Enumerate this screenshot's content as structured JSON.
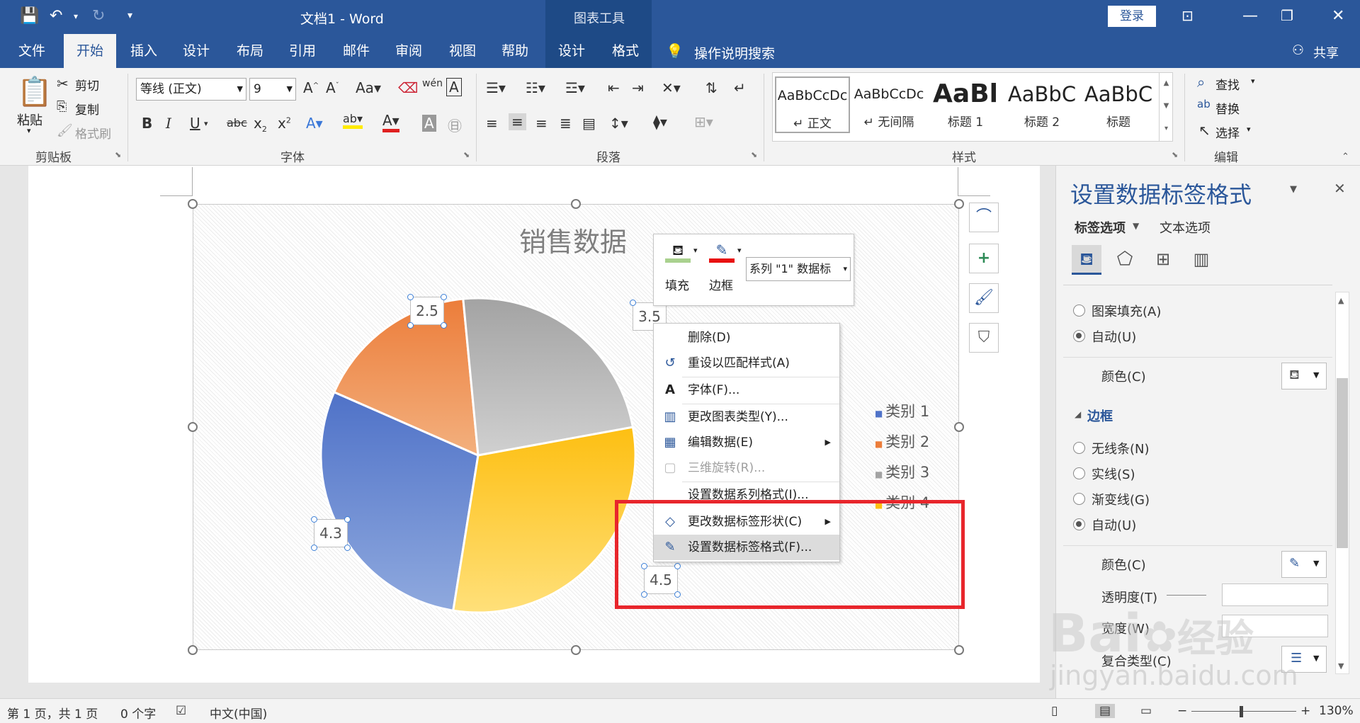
{
  "titlebar": {
    "doc_title": "文档1  -  Word",
    "context_label": "图表工具",
    "login": "登录"
  },
  "tabs": [
    "文件",
    "开始",
    "插入",
    "设计",
    "布局",
    "引用",
    "邮件",
    "审阅",
    "视图",
    "帮助",
    "设计",
    "格式"
  ],
  "tell_me": "操作说明搜索",
  "share": "共享",
  "ribbon": {
    "clipboard": {
      "label": "剪贴板",
      "paste": "粘贴",
      "cut": "剪切",
      "copy": "复制",
      "painter": "格式刷"
    },
    "font": {
      "label": "字体",
      "font_name": "等线 (正文)",
      "font_size": "9"
    },
    "paragraph": {
      "label": "段落"
    },
    "styles": {
      "label": "样式",
      "items": [
        {
          "preview": "AaBbCcDc",
          "name": "↵ 正文"
        },
        {
          "preview": "AaBbCcDc",
          "name": "↵ 无间隔"
        },
        {
          "preview": "AaBl",
          "name": "标题 1"
        },
        {
          "preview": "AaBbC",
          "name": "标题 2"
        },
        {
          "preview": "AaBbC",
          "name": "标题"
        }
      ]
    },
    "editing": {
      "label": "编辑",
      "find": "查找",
      "replace": "替换",
      "select": "选择"
    }
  },
  "chart": {
    "title": "销售数据",
    "labels": [
      "2.5",
      "3.5",
      "4.3",
      "4.5"
    ],
    "legend": [
      "类别 1",
      "类别 2",
      "类别 3",
      "类别 4"
    ]
  },
  "chart_data": {
    "type": "pie",
    "title": "销售数据",
    "categories": [
      "类别 1",
      "类别 2",
      "类别 3",
      "类别 4"
    ],
    "values": [
      4.3,
      2.5,
      3.5,
      4.5
    ],
    "colors": [
      "#5b7fcf",
      "#ee8a4a",
      "#a8a8a8",
      "#fec11a"
    ],
    "legend_position": "right"
  },
  "mini_toolbar": {
    "fill": "填充",
    "border": "边框",
    "series_select": "系列 \"1\" 数据标"
  },
  "context_menu": [
    {
      "label": "删除(D)",
      "icon": "",
      "disabled": false
    },
    {
      "label": "重设以匹配样式(A)",
      "icon": "reset-icon",
      "disabled": false
    },
    {
      "label": "字体(F)...",
      "icon": "font-icon",
      "disabled": false
    },
    {
      "label": "更改图表类型(Y)...",
      "icon": "chart-type-icon",
      "disabled": false
    },
    {
      "label": "编辑数据(E)",
      "icon": "edit-data-icon",
      "disabled": false,
      "submenu": true
    },
    {
      "label": "三维旋转(R)...",
      "icon": "rotate-3d-icon",
      "disabled": true
    },
    {
      "label": "设置数据系列格式(I)...",
      "icon": "",
      "disabled": false
    },
    {
      "label": "更改数据标签形状(C)",
      "icon": "shape-icon",
      "disabled": false,
      "submenu": true
    },
    {
      "label": "设置数据标签格式(F)...",
      "icon": "format-label-icon",
      "disabled": false,
      "highlighted": true
    }
  ],
  "pane": {
    "title": "设置数据标签格式",
    "tab_label_options": "标签选项",
    "tab_text_options": "文本选项",
    "fill_options": [
      "图案填充(A)",
      "自动(U)"
    ],
    "color_label": "颜色(C)",
    "border_heading": "边框",
    "border_options": [
      "无线条(N)",
      "实线(S)",
      "渐变线(G)",
      "自动(U)"
    ],
    "transparency_label": "透明度(T)",
    "width_label": "宽度(W)",
    "compound_label": "复合类型(C)"
  },
  "status": {
    "page": "第 1 页，共 1 页",
    "words": "0 个字",
    "language": "中文(中国)",
    "zoom": "130%"
  },
  "watermark": {
    "text1": "Bai",
    "text2": "经验",
    "text3": "jingyan.baidu.com"
  },
  "accent": "#2b579a",
  "highlight_box_color": "#e8262c"
}
